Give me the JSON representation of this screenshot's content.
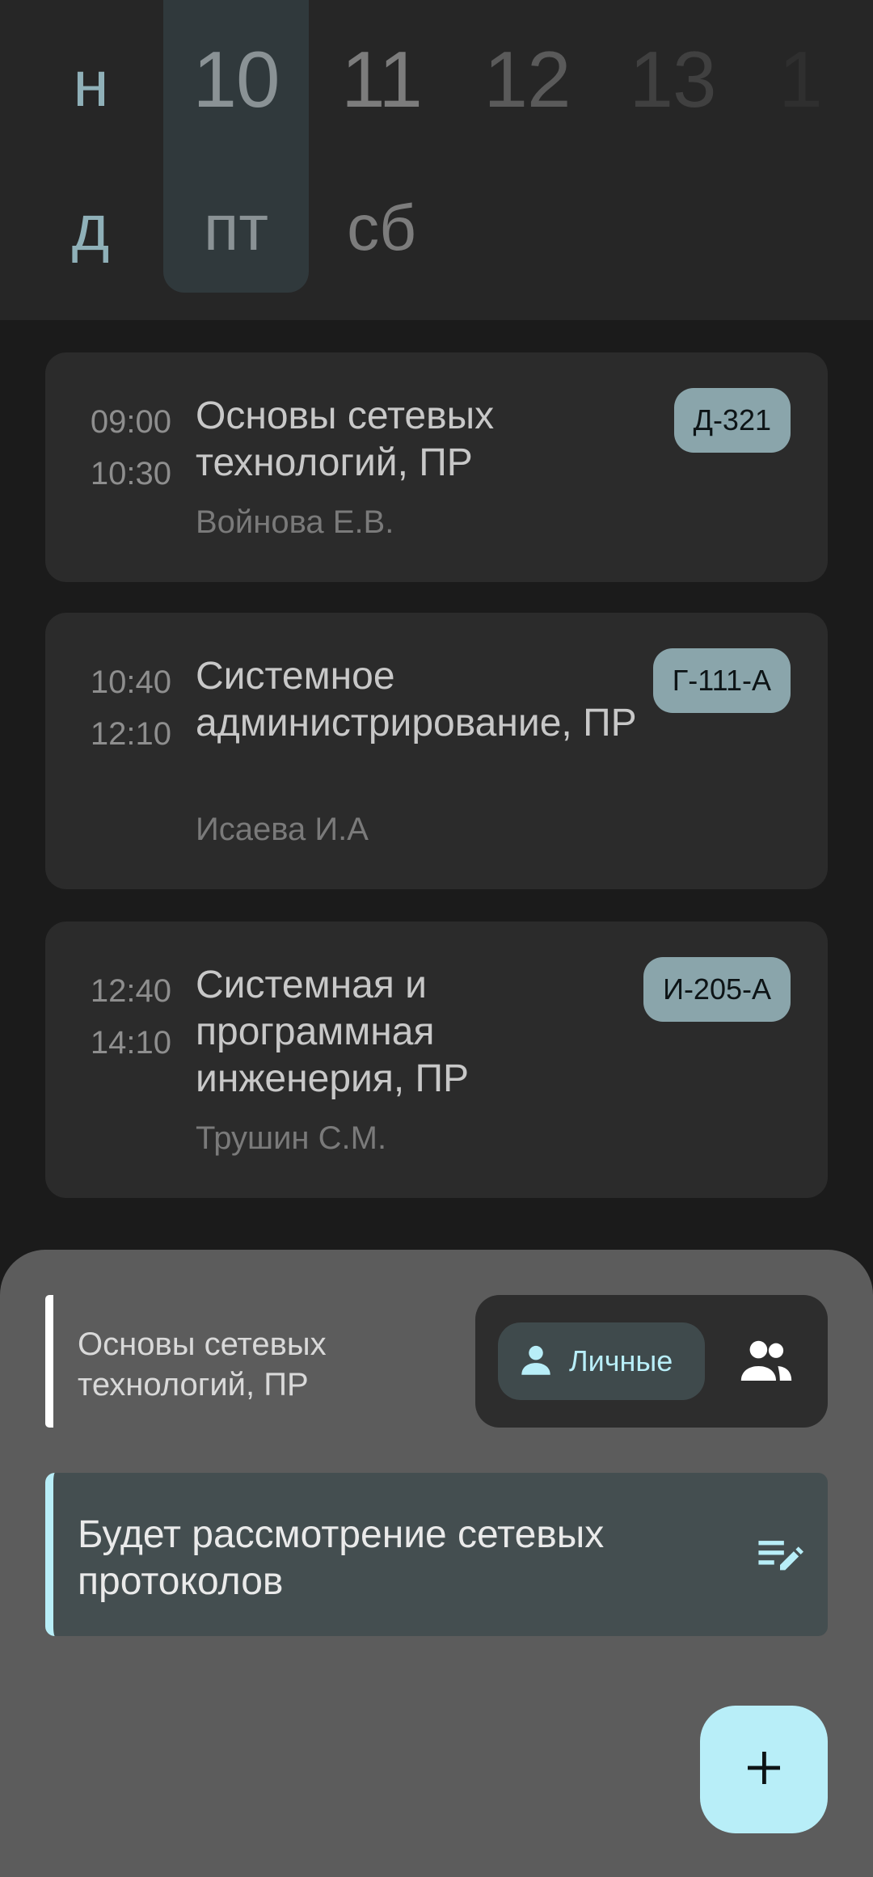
{
  "days": [
    {
      "num": "",
      "name": "н",
      "num_color": "#8fb0b8",
      "name_color": "#8fb0b8",
      "selected": false
    },
    {
      "num": "10",
      "name": "пт",
      "num_color": "#8a9295",
      "name_color": "#8a9295",
      "selected": true
    },
    {
      "num": "11",
      "name": "сб",
      "num_color": "#7c7c7c",
      "name_color": "#7c7c7c",
      "selected": false
    },
    {
      "num": "12",
      "name": "",
      "num_color": "#5a5a5a",
      "name_color": "#5a5a5a",
      "selected": false
    },
    {
      "num": "13",
      "name": "",
      "num_color": "#404040",
      "name_color": "#404040",
      "selected": false
    },
    {
      "num": "1",
      "name": "",
      "num_color": "#2f2f2f",
      "name_color": "#2f2f2f",
      "selected": false
    }
  ],
  "first_day_letters": {
    "top": "н",
    "bottom": "д"
  },
  "lessons": [
    {
      "start": "09:00",
      "end": "10:30",
      "title": "Основы сетевых технологий, ПР",
      "teacher": "Войнова Е.В.",
      "room": "Д-321"
    },
    {
      "start": "10:40",
      "end": "12:10",
      "title": "Системное администрирование, ПР",
      "teacher": "Исаева И.А",
      "room": "Г-111-А"
    },
    {
      "start": "12:40",
      "end": "14:10",
      "title": "Системная и программная инженерия, ПР",
      "teacher": "Трушин С.М.",
      "room": "И-205-А"
    }
  ],
  "sheet": {
    "subject": "Основы сетевых технологий, ПР",
    "personal_label": "Личные",
    "note_text": "Будет рассмотрение сетевых протоколов",
    "icons": {
      "personal": "person-icon",
      "group": "group-icon",
      "edit": "edit-note-icon",
      "fab": "plus-icon"
    }
  },
  "colors": {
    "accent": "#b8eef8",
    "room_chip": "#8aa5ab",
    "sheet": "#5c5c5c"
  }
}
